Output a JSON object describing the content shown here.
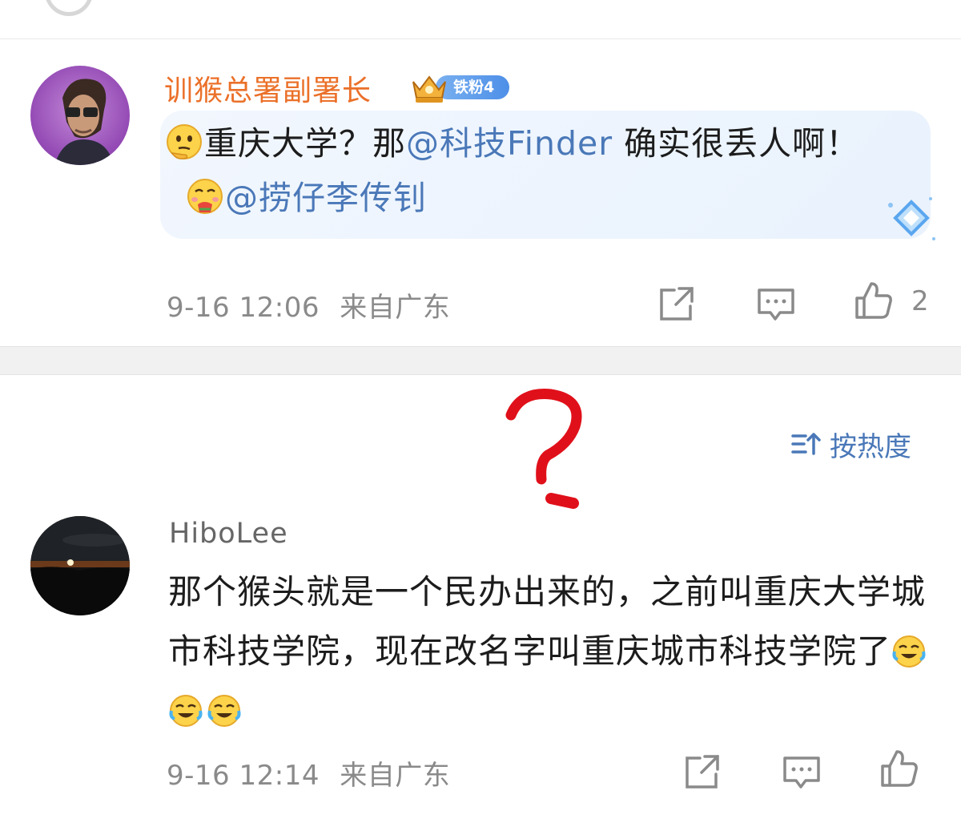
{
  "comment1": {
    "username": "训猴总署副署长",
    "badge": "铁粉4",
    "text_a": "重庆大学？那",
    "mention_a": "@科技Finder",
    "text_b": " 确实很丢人啊！",
    "mention_b": "@捞仔李传钊",
    "time": "9-16 12:06",
    "location": "来自广东",
    "like_count": "2"
  },
  "sort": {
    "label": "按热度"
  },
  "comment2": {
    "username": "HiboLee",
    "text": "那个猴头就是一个民办出来的，之前叫重庆大学城市科技学院，现在改名字叫重庆城市科技学院了",
    "time": "9-16 12:14",
    "location": "来自广东"
  },
  "colors": {
    "username_vip": "#eb7029",
    "mention": "#4a78b8",
    "meta": "#8a8a8a",
    "annotation": "#e0101a"
  },
  "icons": [
    "crown-icon",
    "thinking-emoji-icon",
    "drooling-emoji-icon",
    "crying-laughing-emoji-icon",
    "share-icon",
    "comment-icon",
    "like-icon",
    "sort-icon"
  ]
}
